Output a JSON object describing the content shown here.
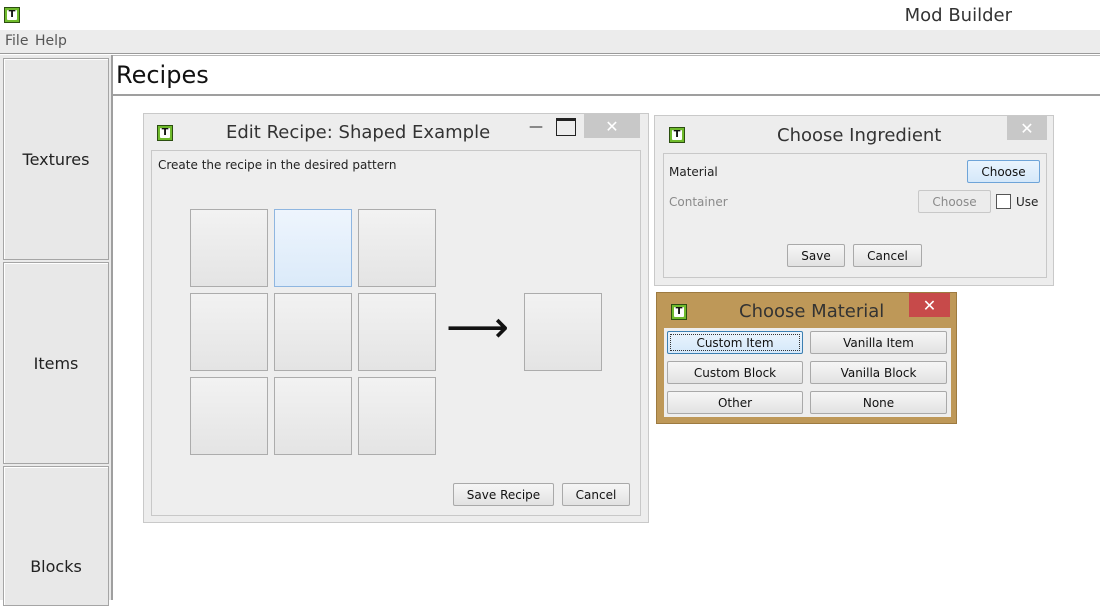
{
  "app": {
    "title": "Mod Builder",
    "icon": "app-logo-icon",
    "icon_letter": "T"
  },
  "menu": {
    "items": [
      "File",
      "Help"
    ]
  },
  "sidebar": {
    "items": [
      {
        "label": "Textures"
      },
      {
        "label": "Items"
      },
      {
        "label": "Blocks"
      }
    ]
  },
  "main": {
    "title": "Recipes"
  },
  "edit_recipe": {
    "title": "Edit Recipe: Shaped Example",
    "instruction": "Create the recipe in the desired pattern",
    "arrow": "⟶",
    "save_label": "Save Recipe",
    "cancel_label": "Cancel",
    "minimize_glyph": "—",
    "maximize_glyph": "☐",
    "close_glyph": "✕"
  },
  "choose_ingredient": {
    "title": "Choose Ingredient",
    "material_label": "Material",
    "material_button": "Choose",
    "container_label": "Container",
    "container_button": "Choose",
    "use_label": "Use",
    "use_checked": false,
    "save_label": "Save",
    "cancel_label": "Cancel",
    "close_glyph": "✕"
  },
  "choose_material": {
    "title": "Choose Material",
    "options": [
      "Custom Item",
      "Vanilla Item",
      "Custom Block",
      "Vanilla Block",
      "Other",
      "None"
    ],
    "close_glyph": "✕"
  },
  "colors": {
    "accent_frame": "#be9858",
    "close_red": "#c74a4a",
    "focus_blue": "#8fb6e0",
    "logo_green": "#6fba2c"
  }
}
